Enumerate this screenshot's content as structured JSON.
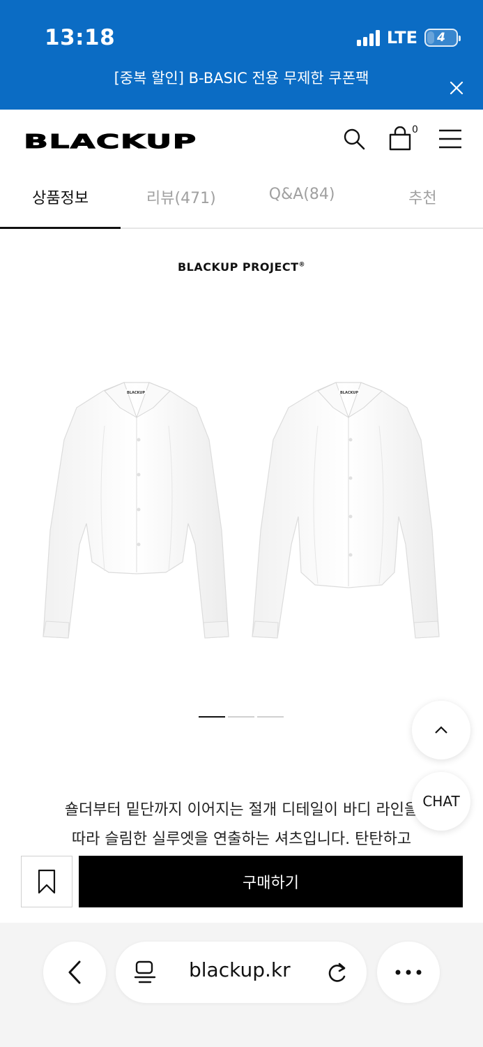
{
  "status_bar": {
    "time": "13:18",
    "network": "LTE",
    "battery": "4"
  },
  "promo_banner": {
    "text": "[중복 할인] B-BASIC 전용 무제한 쿠폰팩"
  },
  "header": {
    "logo": "BLACKUP",
    "cart_count": "0"
  },
  "tabs": [
    {
      "label": "상품정보",
      "active": true
    },
    {
      "label": "리뷰(471)",
      "active": false
    },
    {
      "label": "Q&A(84)",
      "active": false
    },
    {
      "label": "추천",
      "active": false
    }
  ],
  "product": {
    "brand_project": "BLACKUP PROJECT",
    "brand_mark": "®",
    "garment_tag": "BLACKUP",
    "carousel": {
      "total": 3,
      "current": 1
    },
    "description_lines": [
      "숄더부터 밑단까지 이어지는 절개 디테일이 바디 라인을",
      "따라 슬림한 실루엣을 연출하는 셔츠입니다. 탄탄하고"
    ]
  },
  "floating": {
    "chat_label": "CHAT"
  },
  "purchase_bar": {
    "buy_label": "구매하기"
  },
  "browser": {
    "url": "blackup.kr"
  },
  "colors": {
    "banner": "#0b6cc4",
    "buy_button": "#000000",
    "tab_inactive": "#a0a0a0"
  }
}
